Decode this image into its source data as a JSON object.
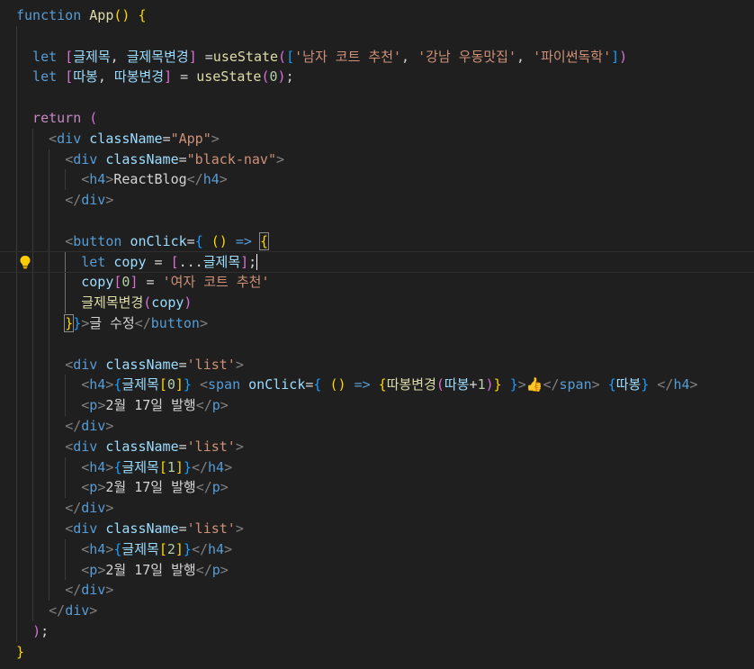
{
  "editor": {
    "language": "javascript-react",
    "cursor_line": 12,
    "lightbulb_line": 12,
    "colors": {
      "background": "#1f1f1f",
      "keyword": "#569cd6",
      "function": "#dcdcaa",
      "variable": "#9cdcfe",
      "string": "#ce9178",
      "number": "#b5cea8",
      "bracket_level1": "#ffd700",
      "bracket_level2": "#da70d6",
      "bracket_level3": "#179fff",
      "control": "#c586c0",
      "lightbulb": "#ffcc00"
    },
    "lines": [
      [
        [
          "kw",
          "function"
        ],
        [
          "txt",
          " "
        ],
        [
          "fn",
          "App"
        ],
        [
          "b1",
          "()"
        ],
        [
          "txt",
          " "
        ],
        [
          "b1",
          "{"
        ]
      ],
      [],
      [
        [
          "kw",
          "  let"
        ],
        [
          "txt",
          " "
        ],
        [
          "b2",
          "["
        ],
        [
          "var",
          "글제목"
        ],
        [
          "txt",
          ", "
        ],
        [
          "var",
          "글제목변경"
        ],
        [
          "b2",
          "]"
        ],
        [
          "txt",
          " ="
        ],
        [
          "fn",
          "useState"
        ],
        [
          "b2",
          "("
        ],
        [
          "b3",
          "["
        ],
        [
          "str",
          "'남자 코트 추천'"
        ],
        [
          "txt",
          ", "
        ],
        [
          "str",
          "'강남 우동맛집'"
        ],
        [
          "txt",
          ", "
        ],
        [
          "str",
          "'파이썬독학'"
        ],
        [
          "b3",
          "]"
        ],
        [
          "b2",
          ")"
        ]
      ],
      [
        [
          "kw",
          "  let"
        ],
        [
          "txt",
          " "
        ],
        [
          "b2",
          "["
        ],
        [
          "var",
          "따봉"
        ],
        [
          "txt",
          ", "
        ],
        [
          "var",
          "따봉변경"
        ],
        [
          "b2",
          "]"
        ],
        [
          "txt",
          " = "
        ],
        [
          "fn",
          "useState"
        ],
        [
          "b2",
          "("
        ],
        [
          "num",
          "0"
        ],
        [
          "b2",
          ")"
        ],
        [
          "txt",
          ";"
        ]
      ],
      [],
      [
        [
          "ctl",
          "  return"
        ],
        [
          "txt",
          " "
        ],
        [
          "b2",
          "("
        ]
      ],
      [
        [
          "txt",
          "    "
        ],
        [
          "tagp",
          "<"
        ],
        [
          "tag",
          "div"
        ],
        [
          "txt",
          " "
        ],
        [
          "attr",
          "className"
        ],
        [
          "txt",
          "="
        ],
        [
          "str",
          "\"App\""
        ],
        [
          "tagp",
          ">"
        ]
      ],
      [
        [
          "txt",
          "      "
        ],
        [
          "tagp",
          "<"
        ],
        [
          "tag",
          "div"
        ],
        [
          "txt",
          " "
        ],
        [
          "attr",
          "className"
        ],
        [
          "txt",
          "="
        ],
        [
          "str",
          "\"black-nav\""
        ],
        [
          "tagp",
          ">"
        ]
      ],
      [
        [
          "txt",
          "        "
        ],
        [
          "tagp",
          "<"
        ],
        [
          "tag",
          "h4"
        ],
        [
          "tagp",
          ">"
        ],
        [
          "txt",
          "ReactBlog"
        ],
        [
          "tagp",
          "</"
        ],
        [
          "tag",
          "h4"
        ],
        [
          "tagp",
          ">"
        ]
      ],
      [
        [
          "txt",
          "      "
        ],
        [
          "tagp",
          "</"
        ],
        [
          "tag",
          "div"
        ],
        [
          "tagp",
          ">"
        ]
      ],
      [],
      [
        [
          "txt",
          "      "
        ],
        [
          "tagp",
          "<"
        ],
        [
          "tag",
          "button"
        ],
        [
          "txt",
          " "
        ],
        [
          "attr",
          "onClick"
        ],
        [
          "txt",
          "="
        ],
        [
          "b3",
          "{"
        ],
        [
          "txt",
          " "
        ],
        [
          "b1",
          "()"
        ],
        [
          "txt",
          " "
        ],
        [
          "kw",
          "=>"
        ],
        [
          "txt",
          " "
        ],
        [
          "b1box",
          "{"
        ]
      ],
      [
        [
          "txt",
          "        "
        ],
        [
          "kw",
          "let"
        ],
        [
          "txt",
          " "
        ],
        [
          "var",
          "copy"
        ],
        [
          "txt",
          " = "
        ],
        [
          "b2",
          "["
        ],
        [
          "txt",
          "..."
        ],
        [
          "var",
          "글제목"
        ],
        [
          "b2",
          "]"
        ],
        [
          "txt",
          ";"
        ],
        [
          "caret",
          ""
        ]
      ],
      [
        [
          "txt",
          "        "
        ],
        [
          "var",
          "copy"
        ],
        [
          "b2",
          "["
        ],
        [
          "num",
          "0"
        ],
        [
          "b2",
          "]"
        ],
        [
          "txt",
          " = "
        ],
        [
          "str",
          "'여자 코트 추천'"
        ]
      ],
      [
        [
          "txt",
          "        "
        ],
        [
          "fn",
          "글제목변경"
        ],
        [
          "b2",
          "("
        ],
        [
          "var",
          "copy"
        ],
        [
          "b2",
          ")"
        ]
      ],
      [
        [
          "txt",
          "      "
        ],
        [
          "b1box",
          "}"
        ],
        [
          "b3",
          "}"
        ],
        [
          "tagp",
          ">"
        ],
        [
          "txt",
          "글 수정"
        ],
        [
          "tagp",
          "</"
        ],
        [
          "tag",
          "button"
        ],
        [
          "tagp",
          ">"
        ]
      ],
      [],
      [
        [
          "txt",
          "      "
        ],
        [
          "tagp",
          "<"
        ],
        [
          "tag",
          "div"
        ],
        [
          "txt",
          " "
        ],
        [
          "attr",
          "className"
        ],
        [
          "txt",
          "="
        ],
        [
          "str",
          "'list'"
        ],
        [
          "tagp",
          ">"
        ]
      ],
      [
        [
          "txt",
          "        "
        ],
        [
          "tagp",
          "<"
        ],
        [
          "tag",
          "h4"
        ],
        [
          "tagp",
          ">"
        ],
        [
          "b3",
          "{"
        ],
        [
          "var",
          "글제목"
        ],
        [
          "b1",
          "["
        ],
        [
          "num",
          "0"
        ],
        [
          "b1",
          "]"
        ],
        [
          "b3",
          "}"
        ],
        [
          "txt",
          " "
        ],
        [
          "tagp",
          "<"
        ],
        [
          "tag",
          "span"
        ],
        [
          "txt",
          " "
        ],
        [
          "attr",
          "onClick"
        ],
        [
          "txt",
          "="
        ],
        [
          "b3",
          "{"
        ],
        [
          "txt",
          " "
        ],
        [
          "b1",
          "()"
        ],
        [
          "txt",
          " "
        ],
        [
          "kw",
          "=>"
        ],
        [
          "txt",
          " "
        ],
        [
          "b1",
          "{"
        ],
        [
          "fn",
          "따봉변경"
        ],
        [
          "b2",
          "("
        ],
        [
          "var",
          "따봉"
        ],
        [
          "txt",
          "+"
        ],
        [
          "num",
          "1"
        ],
        [
          "b2",
          ")"
        ],
        [
          "b1",
          "}"
        ],
        [
          "txt",
          " "
        ],
        [
          "b3",
          "}"
        ],
        [
          "tagp",
          ">"
        ],
        [
          "emoji",
          "👍"
        ],
        [
          "tagp",
          "</"
        ],
        [
          "tag",
          "span"
        ],
        [
          "tagp",
          ">"
        ],
        [
          "txt",
          " "
        ],
        [
          "b3",
          "{"
        ],
        [
          "var",
          "따봉"
        ],
        [
          "b3",
          "}"
        ],
        [
          "txt",
          " "
        ],
        [
          "tagp",
          "</"
        ],
        [
          "tag",
          "h4"
        ],
        [
          "tagp",
          ">"
        ]
      ],
      [
        [
          "txt",
          "        "
        ],
        [
          "tagp",
          "<"
        ],
        [
          "tag",
          "p"
        ],
        [
          "tagp",
          ">"
        ],
        [
          "txt",
          "2월 17일 발행"
        ],
        [
          "tagp",
          "</"
        ],
        [
          "tag",
          "p"
        ],
        [
          "tagp",
          ">"
        ]
      ],
      [
        [
          "txt",
          "      "
        ],
        [
          "tagp",
          "</"
        ],
        [
          "tag",
          "div"
        ],
        [
          "tagp",
          ">"
        ]
      ],
      [
        [
          "txt",
          "      "
        ],
        [
          "tagp",
          "<"
        ],
        [
          "tag",
          "div"
        ],
        [
          "txt",
          " "
        ],
        [
          "attr",
          "className"
        ],
        [
          "txt",
          "="
        ],
        [
          "str",
          "'list'"
        ],
        [
          "tagp",
          ">"
        ]
      ],
      [
        [
          "txt",
          "        "
        ],
        [
          "tagp",
          "<"
        ],
        [
          "tag",
          "h4"
        ],
        [
          "tagp",
          ">"
        ],
        [
          "b3",
          "{"
        ],
        [
          "var",
          "글제목"
        ],
        [
          "b1",
          "["
        ],
        [
          "num",
          "1"
        ],
        [
          "b1",
          "]"
        ],
        [
          "b3",
          "}"
        ],
        [
          "tagp",
          "</"
        ],
        [
          "tag",
          "h4"
        ],
        [
          "tagp",
          ">"
        ]
      ],
      [
        [
          "txt",
          "        "
        ],
        [
          "tagp",
          "<"
        ],
        [
          "tag",
          "p"
        ],
        [
          "tagp",
          ">"
        ],
        [
          "txt",
          "2월 17일 발행"
        ],
        [
          "tagp",
          "</"
        ],
        [
          "tag",
          "p"
        ],
        [
          "tagp",
          ">"
        ]
      ],
      [
        [
          "txt",
          "      "
        ],
        [
          "tagp",
          "</"
        ],
        [
          "tag",
          "div"
        ],
        [
          "tagp",
          ">"
        ]
      ],
      [
        [
          "txt",
          "      "
        ],
        [
          "tagp",
          "<"
        ],
        [
          "tag",
          "div"
        ],
        [
          "txt",
          " "
        ],
        [
          "attr",
          "className"
        ],
        [
          "txt",
          "="
        ],
        [
          "str",
          "'list'"
        ],
        [
          "tagp",
          ">"
        ]
      ],
      [
        [
          "txt",
          "        "
        ],
        [
          "tagp",
          "<"
        ],
        [
          "tag",
          "h4"
        ],
        [
          "tagp",
          ">"
        ],
        [
          "b3",
          "{"
        ],
        [
          "var",
          "글제목"
        ],
        [
          "b1",
          "["
        ],
        [
          "num",
          "2"
        ],
        [
          "b1",
          "]"
        ],
        [
          "b3",
          "}"
        ],
        [
          "tagp",
          "</"
        ],
        [
          "tag",
          "h4"
        ],
        [
          "tagp",
          ">"
        ]
      ],
      [
        [
          "txt",
          "        "
        ],
        [
          "tagp",
          "<"
        ],
        [
          "tag",
          "p"
        ],
        [
          "tagp",
          ">"
        ],
        [
          "txt",
          "2월 17일 발행"
        ],
        [
          "tagp",
          "</"
        ],
        [
          "tag",
          "p"
        ],
        [
          "tagp",
          ">"
        ]
      ],
      [
        [
          "txt",
          "      "
        ],
        [
          "tagp",
          "</"
        ],
        [
          "tag",
          "div"
        ],
        [
          "tagp",
          ">"
        ]
      ],
      [
        [
          "txt",
          "    "
        ],
        [
          "tagp",
          "</"
        ],
        [
          "tag",
          "div"
        ],
        [
          "tagp",
          ">"
        ]
      ],
      [
        [
          "txt",
          "  "
        ],
        [
          "b2",
          ")"
        ],
        [
          "txt",
          ";"
        ]
      ],
      [
        [
          "b1",
          "}"
        ]
      ]
    ]
  }
}
